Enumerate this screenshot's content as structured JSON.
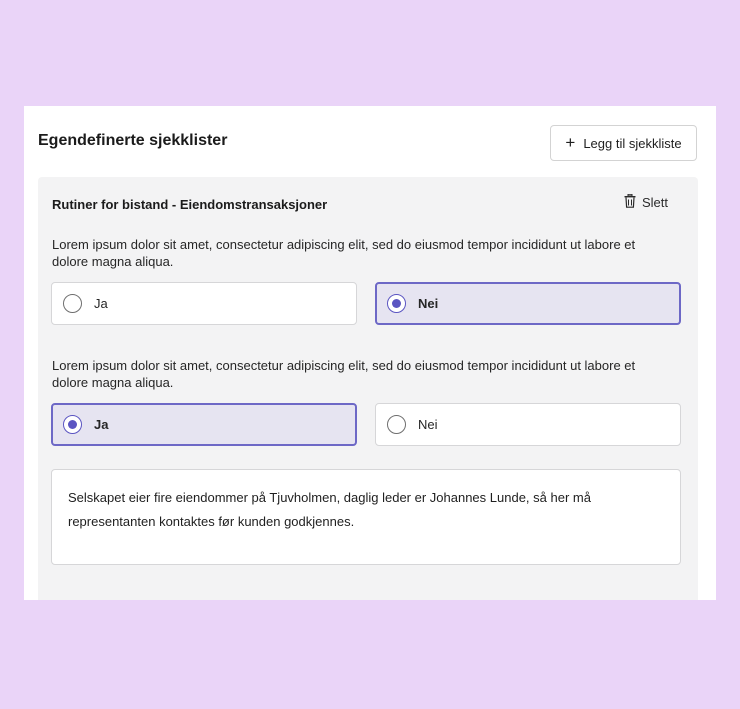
{
  "header": {
    "title": "Egendefinerte sjekklister",
    "add_button_label": "Legg til sjekkliste"
  },
  "checklist": {
    "title": "Rutiner for bistand - Eiendomstransaksjoner",
    "delete_label": "Slett",
    "questions": [
      {
        "text": "Lorem ipsum dolor sit amet, consectetur adipiscing elit, sed do eiusmod tempor incididunt ut labore et dolore magna aliqua.",
        "options": [
          "Ja",
          "Nei"
        ],
        "selected": "Nei"
      },
      {
        "text": "Lorem ipsum dolor sit amet, consectetur adipiscing elit, sed do eiusmod tempor incididunt ut labore et dolore magna aliqua.",
        "options": [
          "Ja",
          "Nei"
        ],
        "selected": "Ja"
      }
    ],
    "comment": "Selskapet eier fire eiendommer på Tjuvholmen, daglig leder er Johannes Lunde, så her må representanten kontaktes før kunden godkjennes."
  },
  "icons": {
    "add": "plus-icon",
    "delete": "trash-icon",
    "radio_selected": "radio-selected-icon",
    "radio_unselected": "radio-unselected-icon"
  },
  "colors": {
    "background": "#ead4f8",
    "accent": "#5b55c2",
    "selected_fill": "#e6e4f1",
    "panel": "#f3f3f4"
  }
}
